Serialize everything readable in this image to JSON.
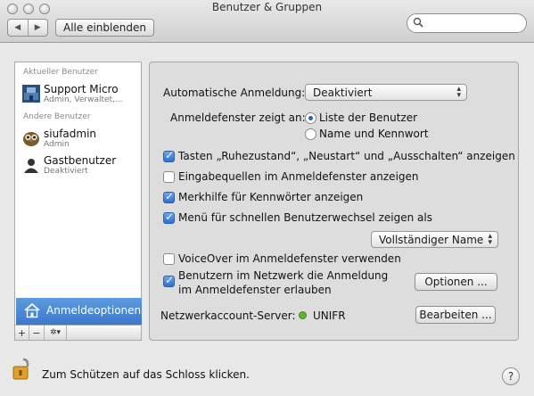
{
  "window": {
    "title": "Benutzer & Gruppen"
  },
  "toolbar": {
    "back_icon": "◀",
    "forward_icon": "▶",
    "show_all_label": "Alle einblenden",
    "search_placeholder": ""
  },
  "sidebar": {
    "current_user_header": "Aktueller Benutzer",
    "other_users_header": "Andere Benutzer",
    "current_user": {
      "name": "Support Micro",
      "sub": "Admin, Verwaltet,..."
    },
    "users": [
      {
        "name": "siufadmin",
        "sub": "Admin"
      },
      {
        "name": "Gastbenutzer",
        "sub": "Deaktiviert"
      }
    ],
    "options_label": "Anmeldeoptionen",
    "add_label": "+",
    "remove_label": "−",
    "action_label": "✲▾"
  },
  "panel": {
    "auto_login_label": "Automatische Anmeldung:",
    "auto_login_value": "Deaktiviert",
    "display_label": "Anmeldefenster zeigt an:",
    "radio_list": "Liste der Benutzer",
    "radio_name": "Name und Kennwort",
    "cb_restart": "Tasten „Ruhezustand“, „Neustart“ und „Ausschalten“ anzeigen",
    "cb_input": "Eingabequellen im Anmeldefenster anzeigen",
    "cb_hints": "Merkhilfe für Kennwörter anzeigen",
    "cb_fastswitch": "Menü für schnellen Benutzerwechsel zeigen als",
    "fastswitch_value": "Vollständiger Name",
    "cb_voiceover": "VoiceOver im Anmeldefenster verwenden",
    "cb_network_line1": "Benutzern im Netzwerk die Anmeldung",
    "cb_network_line2": "im Anmeldefenster erlauben",
    "options_button": "Optionen ...",
    "server_label": "Netzwerkaccount-Server:",
    "server_value": "UNIFR",
    "edit_button": "Bearbeiten ..."
  },
  "footer": {
    "lock_message": "Zum Schützen auf das Schloss klicken.",
    "help_label": "?"
  },
  "colors": {
    "selection": "#4a8ad6",
    "status_green": "#5bb832",
    "checkbox_on": "#2f6fd0"
  }
}
